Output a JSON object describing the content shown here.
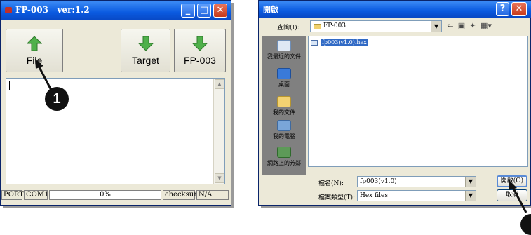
{
  "left_window": {
    "title": "FP-003   ver:1.2",
    "buttons": {
      "file": "File",
      "target": "Target",
      "fp003": "FP-003"
    },
    "status": {
      "port": "PORT",
      "com": "COM1",
      "progress": "0%",
      "checksum_label": "checksum",
      "checksum_value": "N/A"
    },
    "callout": "1"
  },
  "open_dialog": {
    "title": "開啟",
    "look_in_label": "查詢(I):",
    "look_in_value": "FP-003",
    "places": [
      "我最近的文件",
      "桌面",
      "我的文件",
      "我的電腦",
      "網路上的芳鄰"
    ],
    "files": [
      "fp003(v1.0).hex"
    ],
    "filename_label": "檔名(N):",
    "filename_value": "fp003(v1.0)",
    "filetype_label": "檔案類型(T):",
    "filetype_value": "Hex files",
    "open_button": "開啟(O)",
    "cancel_button": "取消"
  },
  "colors": {
    "titlebar": "#0a5ae0",
    "arrow_green": "#4fb04a",
    "selection": "#316ac5"
  },
  "icons": [
    "up-arrow-icon",
    "down-arrow-icon",
    "folder-icon",
    "back-icon",
    "up-folder-icon",
    "new-folder-icon",
    "view-menu-icon",
    "help-icon",
    "close-icon",
    "minimize-icon",
    "maximize-icon"
  ]
}
